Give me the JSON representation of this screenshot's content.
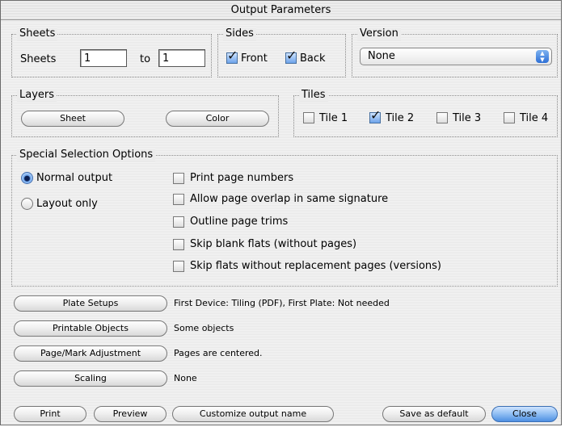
{
  "window": {
    "title": "Output Parameters"
  },
  "sheets": {
    "legend": "Sheets",
    "label": "Sheets",
    "from": "1",
    "to_label": "to",
    "to": "1"
  },
  "sides": {
    "legend": "Sides",
    "front": "Front",
    "back": "Back",
    "front_checked": true,
    "back_checked": true
  },
  "version": {
    "legend": "Version",
    "selected": "None"
  },
  "layers": {
    "legend": "Layers",
    "sheet_button": "Sheet",
    "color_button": "Color"
  },
  "tiles": {
    "legend": "Tiles",
    "items": [
      {
        "label": "Tile 1",
        "checked": false
      },
      {
        "label": "Tile 2",
        "checked": true
      },
      {
        "label": "Tile 3",
        "checked": false
      },
      {
        "label": "Tile 4",
        "checked": false
      }
    ]
  },
  "special": {
    "legend": "Special Selection Options",
    "radios": [
      {
        "label": "Normal output",
        "selected": true
      },
      {
        "label": "Layout only",
        "selected": false
      }
    ],
    "checkboxes": [
      {
        "label": "Print page numbers",
        "checked": false
      },
      {
        "label": "Allow page overlap in same signature",
        "checked": false
      },
      {
        "label": "Outline page trims",
        "checked": false
      },
      {
        "label": "Skip blank flats (without pages)",
        "checked": false
      },
      {
        "label": "Skip flats without replacement pages (versions)",
        "checked": false
      }
    ]
  },
  "settings": [
    {
      "button": "Plate Setups",
      "value": "First Device: Tiling (PDF), First Plate: Not needed"
    },
    {
      "button": "Printable Objects",
      "value": "Some objects"
    },
    {
      "button": "Page/Mark Adjustment",
      "value": "Pages are centered."
    },
    {
      "button": "Scaling",
      "value": "None"
    }
  ],
  "footer": {
    "print": "Print",
    "preview": "Preview",
    "customize": "Customize output name",
    "save_default": "Save as default",
    "close": "Close"
  }
}
